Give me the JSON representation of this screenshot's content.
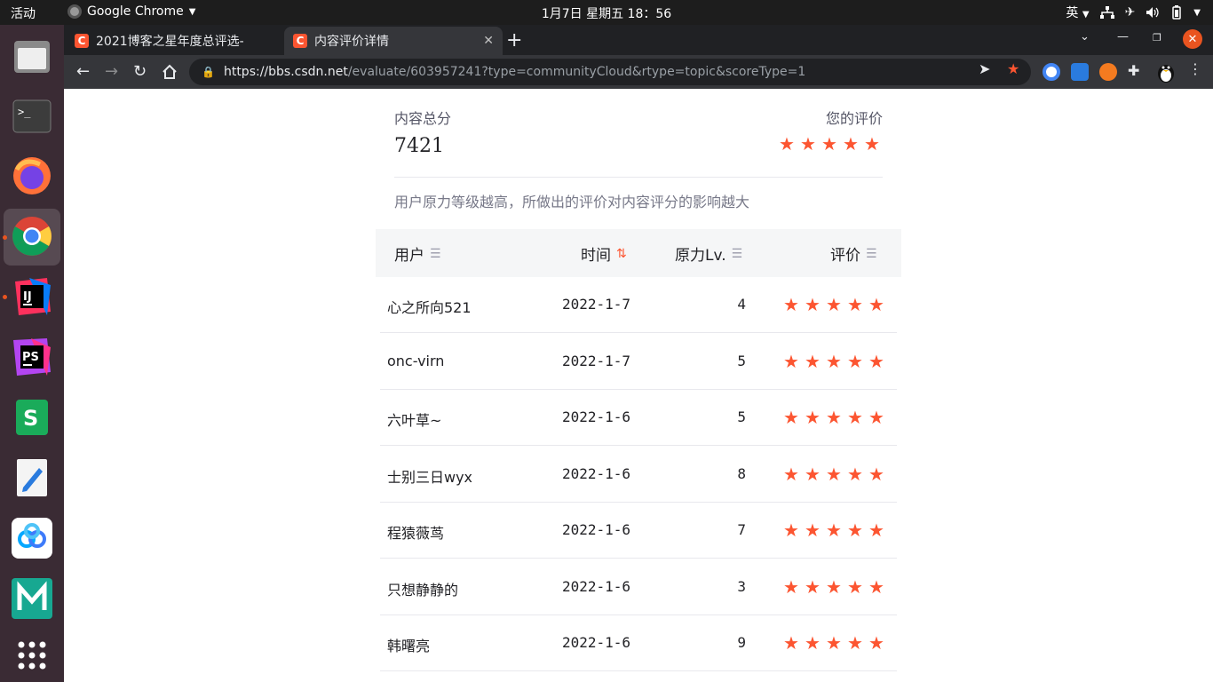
{
  "system": {
    "activities": "活动",
    "app_name": "Google Chrome",
    "clock": "1月7日 星期五  18：56",
    "input_method": "英"
  },
  "browser": {
    "tabs": [
      {
        "label": "2021博客之星年度总评选-",
        "favicon": "C"
      },
      {
        "label": "内容评价详情",
        "favicon": "C"
      }
    ],
    "url_host": "https://bbs.csdn.net",
    "url_path": "/evaluate/603957241?type=communityCloud&rtype=topic&scoreType=1"
  },
  "summary": {
    "total_label": "内容总分",
    "total_value": "7421",
    "my_rating_label": "您的评价",
    "my_rating_stars": 5,
    "hint": "用户原力等级越高，所做出的评价对内容评分的影响越大"
  },
  "table": {
    "headers": {
      "user": "用户",
      "time": "时间",
      "level": "原力Lv.",
      "rating": "评价"
    },
    "rows": [
      {
        "user": "心之所向521",
        "time": "2022-1-7",
        "level": "4",
        "stars": 5
      },
      {
        "user": "onc-virn",
        "time": "2022-1-7",
        "level": "5",
        "stars": 5
      },
      {
        "user": "六叶草~",
        "time": "2022-1-6",
        "level": "5",
        "stars": 5
      },
      {
        "user": "士别三日wyx",
        "time": "2022-1-6",
        "level": "8",
        "stars": 5
      },
      {
        "user": "程猿薇茑",
        "time": "2022-1-6",
        "level": "7",
        "stars": 5
      },
      {
        "user": "只想静静的",
        "time": "2022-1-6",
        "level": "3",
        "stars": 5
      },
      {
        "user": "韩曙亮",
        "time": "2022-1-6",
        "level": "9",
        "stars": 5
      }
    ]
  },
  "colors": {
    "accent": "#fc5531",
    "ubuntu_orange": "#e95420"
  }
}
